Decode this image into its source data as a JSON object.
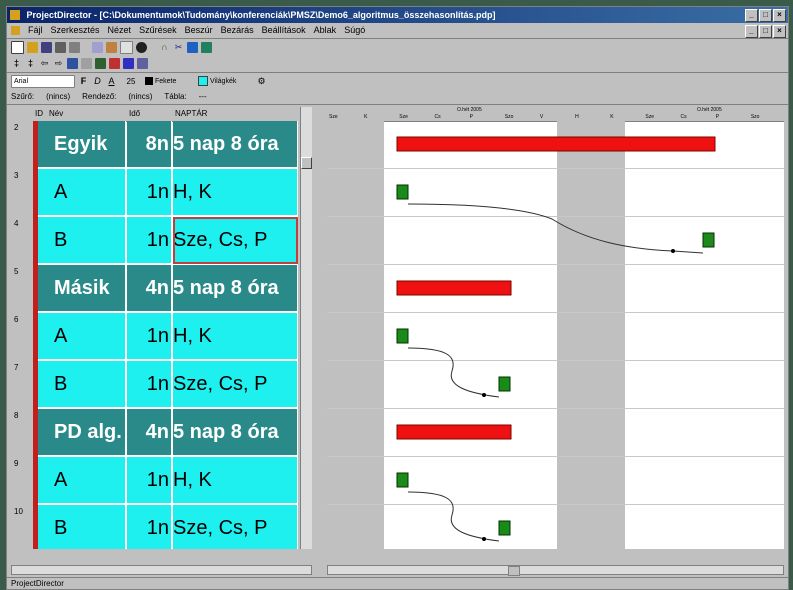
{
  "window": {
    "title": "ProjectDirector - [C:\\Dokumentumok\\Tudomány\\konferenciák\\PMSZ\\Demo6_algoritmus_összehasonlítás.pdp]",
    "controls": [
      "_",
      "□",
      "×"
    ]
  },
  "menu": [
    "Fájl",
    "Szerkesztés",
    "Nézet",
    "Szűrések",
    "Beszúr",
    "Bezárás",
    "Beállítások",
    "Ablak",
    "Súgó"
  ],
  "format_bar": {
    "font": "Arial",
    "size": "25",
    "bold": "F",
    "italic": "D",
    "underline": "A",
    "text_color_label": "Fekete",
    "text_color": "#000000",
    "fill_color_label": "Világkék",
    "fill_color": "#1ef0f0"
  },
  "filter_bar": {
    "filter_label": "Szűrő:",
    "filter_value": "(nincs)",
    "sort_label": "Rendező:",
    "sort_value": "(nincs)",
    "table_label": "Tábla:",
    "table_value": "---"
  },
  "grid": {
    "headers": [
      "ID",
      "Név",
      "Idő",
      "NAPTÁR"
    ],
    "rows": [
      {
        "num": "2",
        "type": "summary",
        "name": "Egyik",
        "dur": "8n",
        "cal": "5 nap 8 óra"
      },
      {
        "num": "3",
        "type": "task",
        "name": "A",
        "dur": "1n",
        "cal": "H, K"
      },
      {
        "num": "4",
        "type": "task",
        "name": "B",
        "dur": "1n",
        "cal": "Sze, Cs, P"
      },
      {
        "num": "5",
        "type": "summary",
        "name": "Másik",
        "dur": "4n",
        "cal": "5 nap 8 óra"
      },
      {
        "num": "6",
        "type": "task",
        "name": "A",
        "dur": "1n",
        "cal": "H, K"
      },
      {
        "num": "7",
        "type": "task",
        "name": "B",
        "dur": "1n",
        "cal": "Sze, Cs, P"
      },
      {
        "num": "8",
        "type": "summary",
        "name": "PD alg.",
        "dur": "4n",
        "cal": "5 nap 8 óra"
      },
      {
        "num": "9",
        "type": "task",
        "name": "A",
        "dur": "1n",
        "cal": "H, K"
      },
      {
        "num": "10",
        "type": "task",
        "name": "B",
        "dur": "1n",
        "cal": "Sze, Cs, P"
      }
    ]
  },
  "gantt": {
    "header_top": [
      "Ő.hét 2005",
      "Ő.hét 2005"
    ],
    "header_days": [
      "Sze",
      "K",
      "Sze",
      "Cs",
      "P",
      "Szo",
      "V",
      "H",
      "K",
      "Sze",
      "Cs",
      "P",
      "Szo"
    ],
    "summary_color": "#ee1111",
    "task_color": "#1a8a1a",
    "weekend_color": "#c0c0c0"
  },
  "status": {
    "text": "ProjectDirector"
  }
}
